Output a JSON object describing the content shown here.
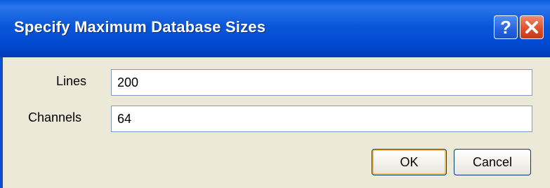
{
  "window": {
    "title": "Specify Maximum Database Sizes",
    "help_label": "?"
  },
  "icons": {
    "help": "question-mark-icon",
    "close": "close-x-icon"
  },
  "form": {
    "lines_label": "Lines",
    "lines_value": "200",
    "channels_label": "Channels",
    "channels_value": "64"
  },
  "buttons": {
    "ok_label": "OK",
    "cancel_label": "Cancel"
  },
  "colors": {
    "titlebar": "#0a56d8",
    "close_button": "#e0502c",
    "dialog_background": "#ece9d8",
    "field_border": "#7f9db9"
  }
}
